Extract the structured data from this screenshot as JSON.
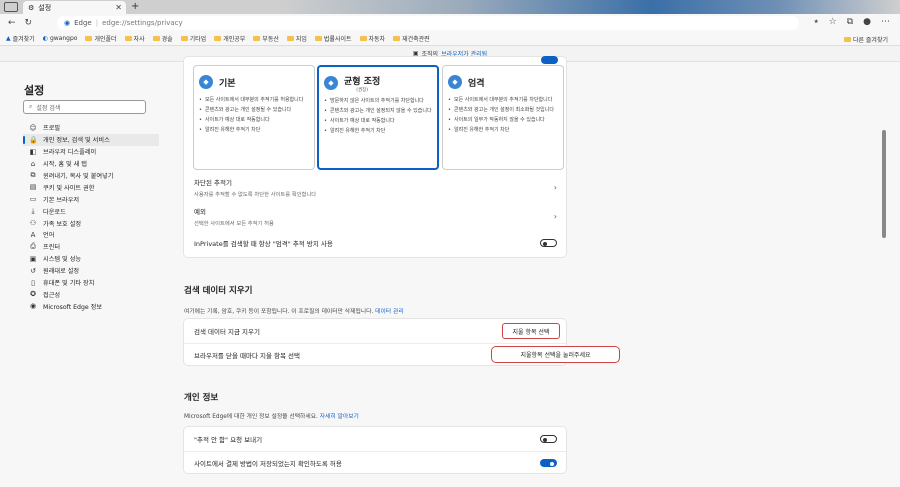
{
  "tab": {
    "title": "설정"
  },
  "address": {
    "brand": "Edge",
    "url": "edge://settings/privacy"
  },
  "bookmarks": {
    "items": [
      "즐겨찾기",
      "gwangpo",
      "개인폴더",
      "자사",
      "경솔",
      "기타업",
      "개인공부",
      "부동산",
      "지임",
      "법률사이트",
      "자동차",
      "재건축관련"
    ],
    "other": "다른 즐겨찾기"
  },
  "infobar": {
    "text": "조직의",
    "link": "브라우저가 관리됨"
  },
  "sidebar": {
    "title": "설정",
    "search_placeholder": "설정 검색",
    "items": [
      {
        "label": "프로필",
        "icon": "profile-icon"
      },
      {
        "label": "개인 정보, 검색 및 서비스",
        "icon": "lock-icon"
      },
      {
        "label": "브라우저 디스플레이",
        "icon": "appearance-icon"
      },
      {
        "label": "시작, 홈 및 새 탭",
        "icon": "start-icon"
      },
      {
        "label": "윈려내기, 복사 및 붙여넣기",
        "icon": "share-icon"
      },
      {
        "label": "쿠키 및 사이트 권한",
        "icon": "cookie-icon"
      },
      {
        "label": "기본 브라우저",
        "icon": "browser-icon"
      },
      {
        "label": "다운로드",
        "icon": "download-icon"
      },
      {
        "label": "가족 보호 설정",
        "icon": "family-icon"
      },
      {
        "label": "언어",
        "icon": "language-icon"
      },
      {
        "label": "프린터",
        "icon": "printer-icon"
      },
      {
        "label": "시스템 및 성능",
        "icon": "system-icon"
      },
      {
        "label": "원래대로 설정",
        "icon": "reset-icon"
      },
      {
        "label": "휴대폰 및 기타 장치",
        "icon": "phone-icon"
      },
      {
        "label": "접근성",
        "icon": "accessibility-icon"
      },
      {
        "label": "Microsoft Edge 정보",
        "icon": "edge-icon"
      }
    ]
  },
  "tracking": {
    "levels": [
      {
        "title": "기본",
        "sub": "",
        "bullets": [
          "모든 사이트에서 대부분의 추적기를 허용합니다",
          "콘텐츠와 광고는 개인 설정될 수 있습니다",
          "사이트가 예상 대로 작동합니다",
          "알려진 유해한 추적기 차단"
        ]
      },
      {
        "title": "균형 조정",
        "sub": "(권장)",
        "bullets": [
          "방문하지 않은 사이트의 추적기를 차단합니다",
          "콘텐츠와 광고는 개인 설정되지 않을 수 있습니다",
          "사이트가 예상 대로 작동합니다",
          "알려진 유해한 추적기 차단"
        ]
      },
      {
        "title": "엄격",
        "sub": "",
        "bullets": [
          "모든 사이트에서 대부분의 추적기를 차단합니다",
          "콘텐츠와 광고는 개인 설정이 최소화될 것입니다",
          "사이트의 일부가 작동하지 않을 수 있습니다",
          "알려진 유해한 추적기 차단"
        ]
      }
    ],
    "blocked_title": "차단된 추적기",
    "blocked_desc": "사용자를 추적할 수 없도록 차단한 사이트를 확인합니다",
    "exceptions_title": "예외",
    "exceptions_desc": "선택한 사이트에서 모든 추적기 허용",
    "inprivate_label": "InPrivate를 검색할 때 항상 \"엄격\" 추적 방지 사용"
  },
  "clear": {
    "title": "검색 데이터 지우기",
    "desc": "여기에는 기록, 암호, 쿠키 등이 포함됩니다. 이 프로필의 데이터만 삭제됩니다.",
    "desc_link": "데이터 관리",
    "now_label": "검색 데이터 지금 지우기",
    "now_button": "지울 항목 선택",
    "onclose_label": "브라우저를 닫을 때마다 지울 항목 선택",
    "onclose_note": "지울항목 선택을 눌러주세요"
  },
  "privacy": {
    "title": "개인 정보",
    "desc": "Microsoft Edge에 대한 개인 정보 설정을 선택하세요.",
    "desc_link": "자세히 알아보기",
    "dnt_label": "\"추적 안 함\" 요청 보내기",
    "payment_label": "사이트에서 결제 방법이 저장되었는지 확인하도록 허용"
  },
  "colors": {
    "accent": "#0b62c4",
    "annotation": "#cc4444"
  }
}
